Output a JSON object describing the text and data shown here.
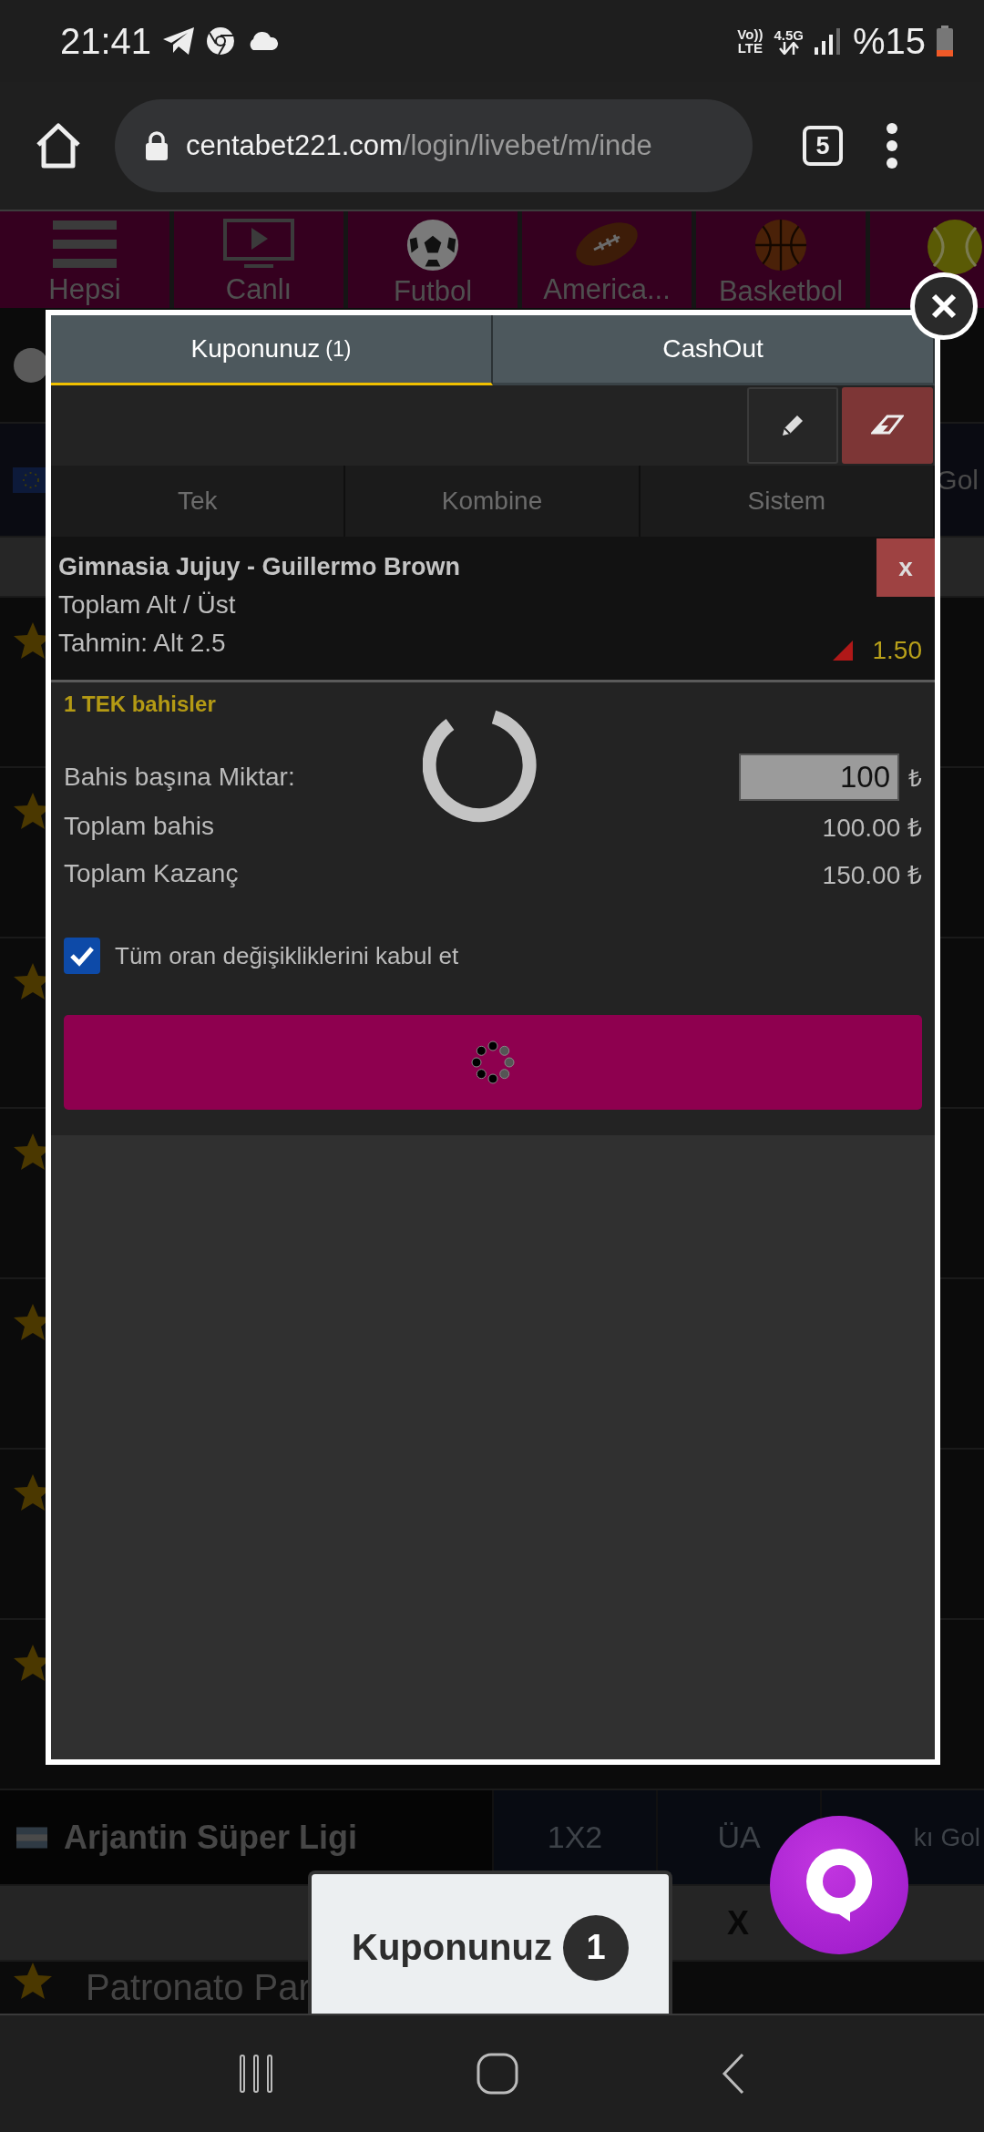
{
  "status_bar": {
    "time": "21:41",
    "volte_top": "Vo))",
    "volte_bottom": "LTE",
    "data_type": "4.5G",
    "battery": "%15"
  },
  "browser": {
    "url_host": "centabet221.com",
    "url_path": "/login/livebet/m/inde",
    "tab_count": "5"
  },
  "sport_tabs": [
    {
      "kind": "menu",
      "label": "Hepsi"
    },
    {
      "kind": "tv",
      "label": "Canlı"
    },
    {
      "kind": "soccer",
      "label": "Futbol"
    },
    {
      "kind": "football",
      "label": "America..."
    },
    {
      "kind": "basketball",
      "label": "Basketbol"
    },
    {
      "kind": "tennis"
    }
  ],
  "background": {
    "header_cell": "Gol",
    "match_rows": [
      {
        "favorite": true
      },
      {
        "favorite": true
      },
      {
        "favorite": true
      },
      {
        "favorite": true
      },
      {
        "favorite": true
      },
      {
        "favorite": true
      },
      {
        "favorite": true
      }
    ],
    "league": {
      "name": "Arjantin Süper Ligi",
      "columns": [
        "1X2",
        "ÜA",
        "kı Gol"
      ]
    },
    "odds_header": "X",
    "match": {
      "name": "Patronato Par",
      "favorite": true
    }
  },
  "coupon": {
    "tabs": [
      {
        "label": "Kuponunuz",
        "count": "(1)",
        "selected": true
      },
      {
        "label": "CashOut",
        "selected": false
      }
    ],
    "bet_types": [
      {
        "label": "Tek",
        "disabled": true
      },
      {
        "label": "Kombine",
        "disabled": true
      },
      {
        "label": "Sistem",
        "disabled": true
      }
    ],
    "selection": {
      "match": "Gimnasia Jujuy - Guillermo Brown",
      "market": "Toplam Alt / Üst",
      "prediction": "Tahmin: Alt 2.5",
      "odds": "1.50",
      "odds_dropped": true,
      "remove": "x"
    },
    "section_title": "1 TEK bahisler",
    "stake": {
      "label": "Bahis başına Miktar:",
      "value": "100",
      "currency": "₺"
    },
    "totals": [
      {
        "label": "Toplam bahis",
        "value": "100.00 ₺"
      },
      {
        "label": "Toplam Kazanç",
        "value": "150.00 ₺"
      }
    ],
    "accept_changes": {
      "label": "Tüm oran değişikliklerini kabul et",
      "checked": true
    },
    "loading": true,
    "submit": {
      "loading": true
    }
  },
  "floating_coupon": {
    "label": "Kuponunuz",
    "count": "1"
  }
}
